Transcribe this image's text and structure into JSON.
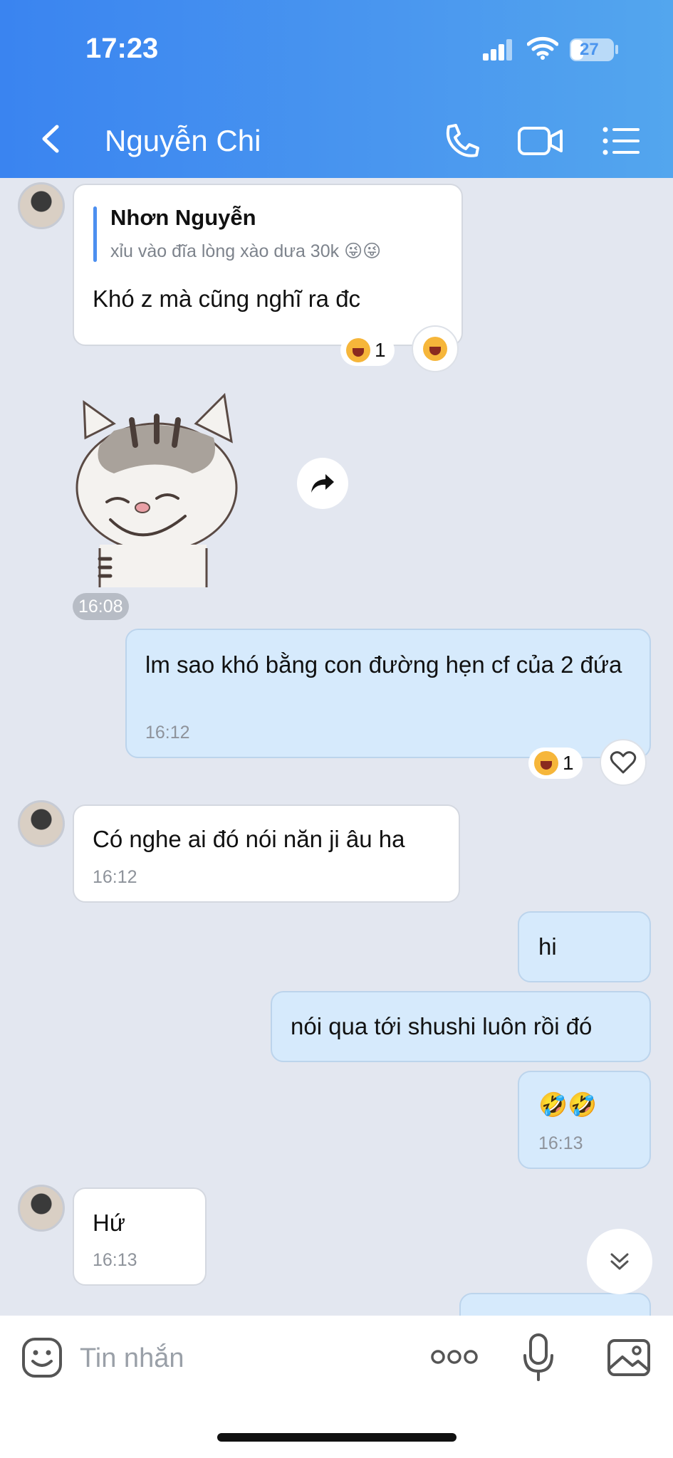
{
  "status_bar": {
    "time": "17:23",
    "battery": "27"
  },
  "header": {
    "contact_name": "Nguyễn Chi"
  },
  "messages": {
    "m1": {
      "quote_author": "Nhơn Nguyễn",
      "quote_text": "xỉu vào đĩa lòng xào dưa 30k 😜😜",
      "text": "Khó z mà cũng nghĩ ra đc",
      "reaction_count": "1"
    },
    "sticker": {
      "time": "16:08"
    },
    "m2": {
      "text": "lm sao khó bằng con đường hẹn cf của 2 đứa",
      "time": "16:12",
      "reaction_count": "1"
    },
    "m3": {
      "text": "Có nghe ai đó nói năn ji âu ha",
      "time": "16:12"
    },
    "m4": {
      "text": "hi"
    },
    "m5": {
      "text": "nói qua tới shushi luôn rồi đó"
    },
    "m6": {
      "text": "🤣🤣",
      "time": "16:13"
    },
    "m7": {
      "text": "Hứ",
      "time": "16:13"
    }
  },
  "input": {
    "placeholder": "Tin nhắn"
  }
}
